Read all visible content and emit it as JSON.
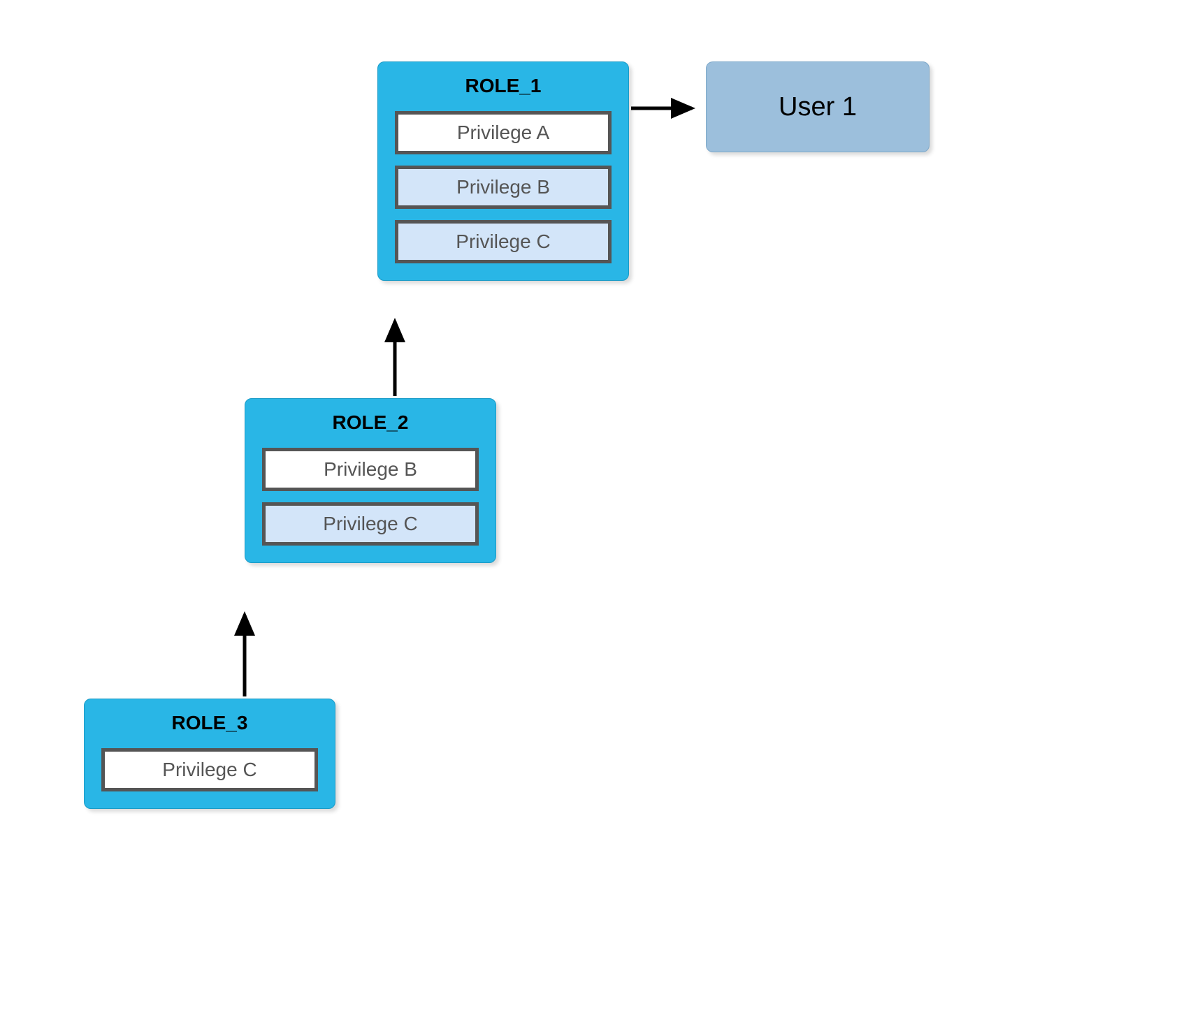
{
  "roles": {
    "role1": {
      "title": "ROLE_1",
      "privileges": [
        {
          "label": "Privilege A",
          "inherited": false
        },
        {
          "label": "Privilege B",
          "inherited": true
        },
        {
          "label": "Privilege C",
          "inherited": true
        }
      ]
    },
    "role2": {
      "title": "ROLE_2",
      "privileges": [
        {
          "label": "Privilege B",
          "inherited": false
        },
        {
          "label": "Privilege C",
          "inherited": true
        }
      ]
    },
    "role3": {
      "title": "ROLE_3",
      "privileges": [
        {
          "label": "Privilege C",
          "inherited": false
        }
      ]
    }
  },
  "user": {
    "label": "User 1"
  }
}
